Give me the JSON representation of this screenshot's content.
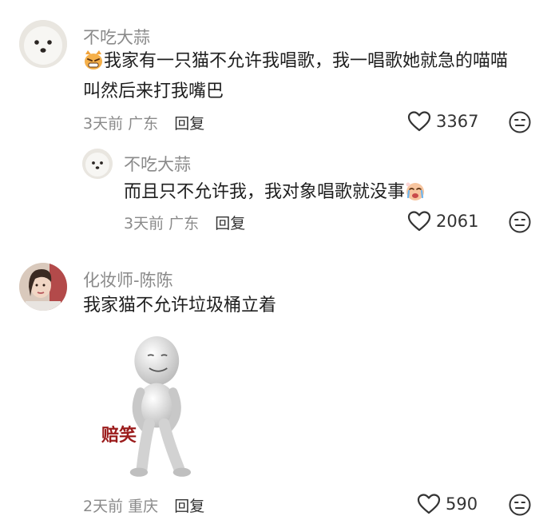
{
  "comments": [
    {
      "username": "不吃大蒜",
      "emoji": "angry-cat-emoji",
      "text_line1": "我家有一只猫不允许我唱歌，我一唱歌她就急的喵喵",
      "text_line2": "叫然后来打我嘴巴",
      "time": "3天前",
      "location": "广东",
      "reply_label": "回复",
      "likes": "3367",
      "replies": [
        {
          "username": "不吃大蒜",
          "text": "而且只不允许我，我对象唱歌就没事",
          "emoji": "crying-emoji",
          "time": "3天前",
          "location": "广东",
          "reply_label": "回复",
          "likes": "2061"
        }
      ]
    },
    {
      "username": "化妆师-陈陈",
      "text": "我家猫不允许垃圾桶立着",
      "sticker_label": "赔笑",
      "time": "2天前",
      "location": "重庆",
      "reply_label": "回复",
      "likes": "590"
    }
  ]
}
